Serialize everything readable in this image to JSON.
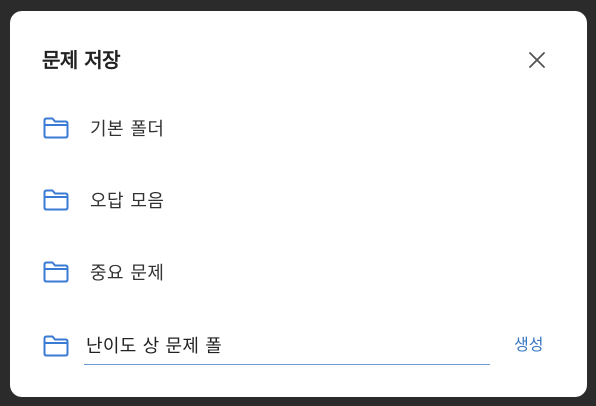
{
  "dialog": {
    "title": "문제 저장",
    "close_icon": "close-icon"
  },
  "folders": [
    {
      "label": "기본 폴더",
      "icon": "folder-icon"
    },
    {
      "label": "오답 모음",
      "icon": "folder-icon"
    },
    {
      "label": "중요 문제",
      "icon": "folder-icon"
    }
  ],
  "new_folder": {
    "value": "난이도 상 문제 폴",
    "icon": "folder-icon",
    "create_label": "생성"
  },
  "colors": {
    "accent": "#3a78c4",
    "folder_icon": "#3a7bd5",
    "title": "#222222",
    "backdrop": "#2b2b2b"
  }
}
